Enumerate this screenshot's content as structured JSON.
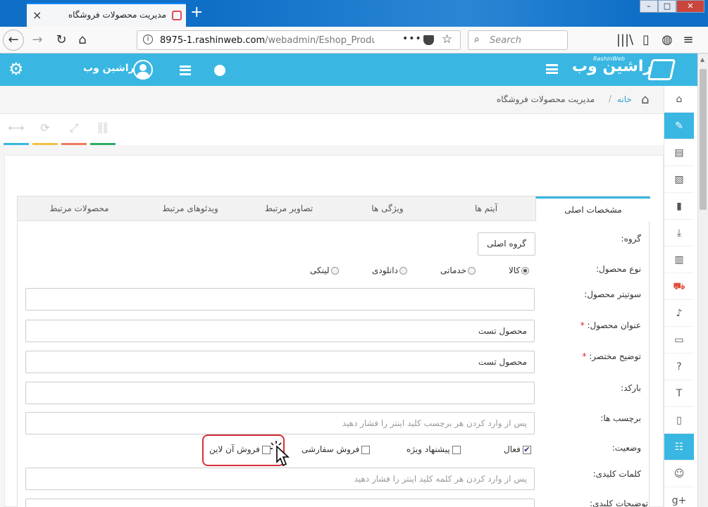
{
  "browser": {
    "tab_title": "مدیریت محصولات فروشگاه",
    "url_host": "8975-1.rashinweb.com",
    "url_path": "/webadmin/Eshop_Products",
    "search_placeholder": "Search"
  },
  "header": {
    "user_name": "راشین وب",
    "logo_text": "راشین وب",
    "logo_small": "RashinWeb"
  },
  "breadcrumb": {
    "home": "خانه",
    "separator": "/",
    "current": "مدیریت محصولات فروشگاه"
  },
  "toolbar": {
    "colors": [
      "#39b7e2",
      "#f5c044",
      "#f07a5e",
      "#2dae68"
    ]
  },
  "tabs": [
    {
      "label": "مشخصات اصلی",
      "active": true
    },
    {
      "label": "آیتم ها"
    },
    {
      "label": "ویژگی ها"
    },
    {
      "label": "تصاویر مرتبط"
    },
    {
      "label": "ویدئوهای مرتبط"
    },
    {
      "label": "محصولات مرتبط"
    }
  ],
  "form": {
    "group_label": "گروه:",
    "group_button": "گروه اصلی",
    "type_label": "نوع محصول:",
    "types": [
      "کالا",
      "خدماتی",
      "دانلودی",
      "لینکی"
    ],
    "subtitle_label": "سوتیتر محصول:",
    "title_label": "عنوان محصول:",
    "title_value": "محصول تست",
    "desc_label": "توضیح مختصر:",
    "desc_value": "محصول تست",
    "barcode_label": "بارکد:",
    "tags_label": "برچسب ها:",
    "tags_placeholder": "پس از وارد کردن هر برچسب کلید اینتر را فشار دهید",
    "status_label": "وضعیت:",
    "status": [
      "فعال",
      "پیشنهاد ویژه",
      "فروش سفارشی",
      "فروش آن لاین"
    ],
    "keywords_label": "کلمات کلیدی:",
    "keywords_placeholder": "پس از وارد کردن هر کلمه کلید اینتر را فشار دهید",
    "keydesc_label": "توضیحات کلیدی:",
    "required_mark": "*"
  }
}
